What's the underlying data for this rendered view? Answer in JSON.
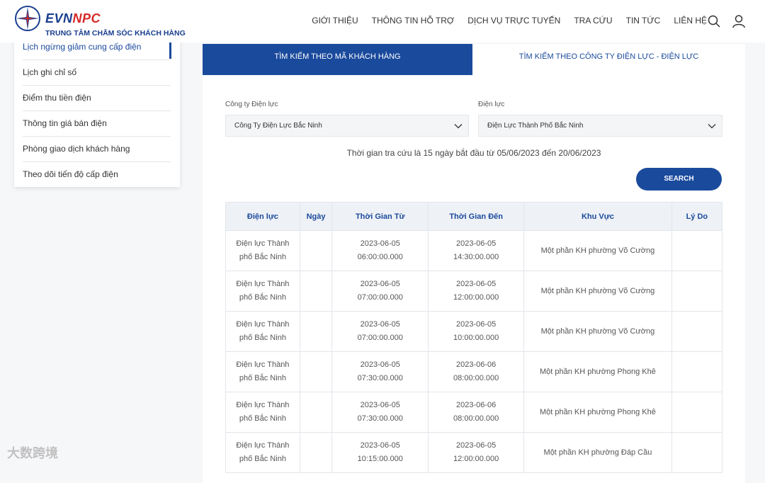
{
  "header": {
    "brand_evn": "EVN",
    "brand_npc": "NPC",
    "subtitle": "TRUNG TÂM CHĂM SÓC KHÁCH HÀNG",
    "nav": [
      "GIỚI THIỆU",
      "THÔNG TIN HỖ TRỢ",
      "DỊCH VỤ TRỰC TUYẾN",
      "TRA CỨU",
      "TIN TỨC",
      "LIÊN HỆ"
    ],
    "icons": [
      "search-icon",
      "user-icon"
    ]
  },
  "sidebar": {
    "items": [
      {
        "label": "Lịch ngừng giảm cung cấp điện",
        "active": true
      },
      {
        "label": "Lịch ghi chỉ số"
      },
      {
        "label": "Điểm thu tiền điện"
      },
      {
        "label": "Thông tin giá bán điện"
      },
      {
        "label": "Phòng giao dịch khách hàng"
      },
      {
        "label": "Theo dõi tiến độ cấp điện"
      }
    ]
  },
  "tabs": {
    "active": "TÌM KIẾM THEO MÃ KHÁCH HÀNG",
    "inactive": "TÌM KIẾM THEO CÔNG TY ĐIỆN LỰC - ĐIỆN LỰC"
  },
  "form": {
    "company_label": "Công ty Điện lực",
    "company_value": "Công Ty Điện Lực Bắc Ninh",
    "district_label": "Điện lực",
    "district_value": "Điện Lực Thành Phố Bắc Ninh",
    "note": "Thời gian tra cứu là 15 ngày bắt đầu từ 05/06/2023 đến 20/06/2023",
    "search_label": "SEARCH"
  },
  "table": {
    "headers": [
      "Điện lực",
      "Ngày",
      "Thời Gian Từ",
      "Thời Gian Đến",
      "Khu Vực",
      "Lý Do"
    ],
    "rows": [
      {
        "dien_luc": "Điện lực Thành phố Bắc Ninh",
        "ngay": "",
        "tu_date": "2023-06-05",
        "tu_time": "06:00:00.000",
        "den_date": "2023-06-05",
        "den_time": "14:30:00.000",
        "khu_vuc": "Một phần KH phường Võ Cường",
        "ly_do": ""
      },
      {
        "dien_luc": "Điện lực Thành phố Bắc Ninh",
        "ngay": "",
        "tu_date": "2023-06-05",
        "tu_time": "07:00:00.000",
        "den_date": "2023-06-05",
        "den_time": "12:00:00.000",
        "khu_vuc": "Một phần KH phường Võ Cường",
        "ly_do": ""
      },
      {
        "dien_luc": "Điện lực Thành phố Bắc Ninh",
        "ngay": "",
        "tu_date": "2023-06-05",
        "tu_time": "07:00:00.000",
        "den_date": "2023-06-05",
        "den_time": "10:00:00.000",
        "khu_vuc": "Một phần KH phường Võ Cường",
        "ly_do": ""
      },
      {
        "dien_luc": "Điện lực Thành phố Bắc Ninh",
        "ngay": "",
        "tu_date": "2023-06-05",
        "tu_time": "07:30:00.000",
        "den_date": "2023-06-06",
        "den_time": "08:00:00.000",
        "khu_vuc": "Một phần KH phường Phong Khê",
        "ly_do": ""
      },
      {
        "dien_luc": "Điện lực Thành phố Bắc Ninh",
        "ngay": "",
        "tu_date": "2023-06-05",
        "tu_time": "07:30:00.000",
        "den_date": "2023-06-06",
        "den_time": "08:00:00.000",
        "khu_vuc": "Một phần KH phường Phong Khê",
        "ly_do": ""
      },
      {
        "dien_luc": "Điện lực Thành phố Bắc Ninh",
        "ngay": "",
        "tu_date": "2023-06-05",
        "tu_time": "10:15:00.000",
        "den_date": "2023-06-05",
        "den_time": "12:00:00.000",
        "khu_vuc": "Một phần KH phường Đáp Cầu",
        "ly_do": ""
      }
    ]
  },
  "watermark": "大数跨境",
  "colors": {
    "primary": "#1a4a9c",
    "brand_red": "#d62828",
    "brand_blue": "#1a3f8f"
  }
}
